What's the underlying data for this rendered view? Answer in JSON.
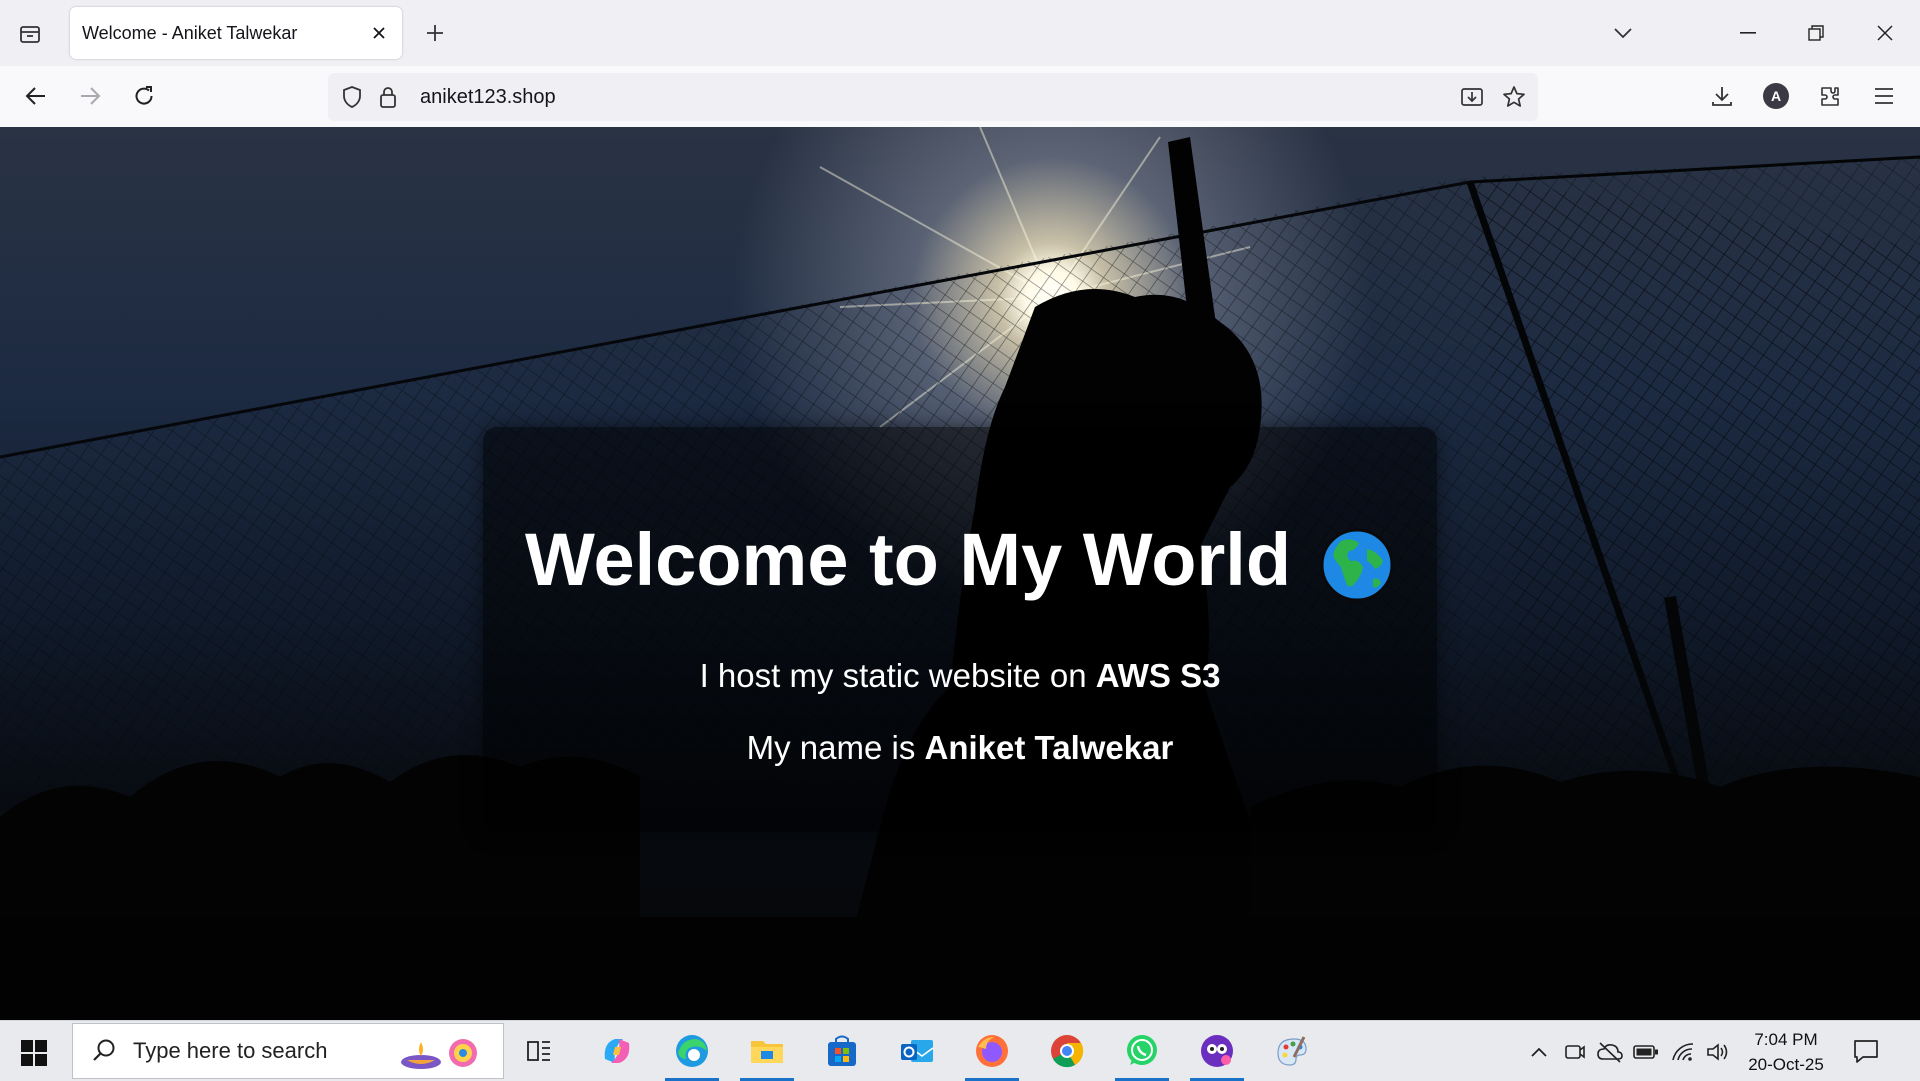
{
  "browser": {
    "tab_title": "Welcome - Aniket Talwekar",
    "url": "aniket123.shop",
    "account_initial": "A"
  },
  "page": {
    "headline": "Welcome to My World",
    "headline_icon": "globe-emoji",
    "line1_prefix": "I host my static website on ",
    "line1_bold": "AWS S3",
    "line2_prefix": "My name is ",
    "line2_bold": "Aniket Talwekar",
    "background": "silhouette of cricket batsman in practice nets against bright sun"
  },
  "taskbar": {
    "search_placeholder": "Type here to search",
    "apps": [
      "task-view",
      "copilot",
      "edge",
      "file-explorer",
      "microsoft-store",
      "outlook",
      "firefox",
      "chrome",
      "whatsapp",
      "clipchamp",
      "paint"
    ],
    "time": "7:04 PM",
    "date": "20-Oct-25"
  },
  "colors": {
    "accent": "#1a73c8",
    "tab_strip": "#f0f0f4",
    "taskbar": "#e8eaee"
  }
}
